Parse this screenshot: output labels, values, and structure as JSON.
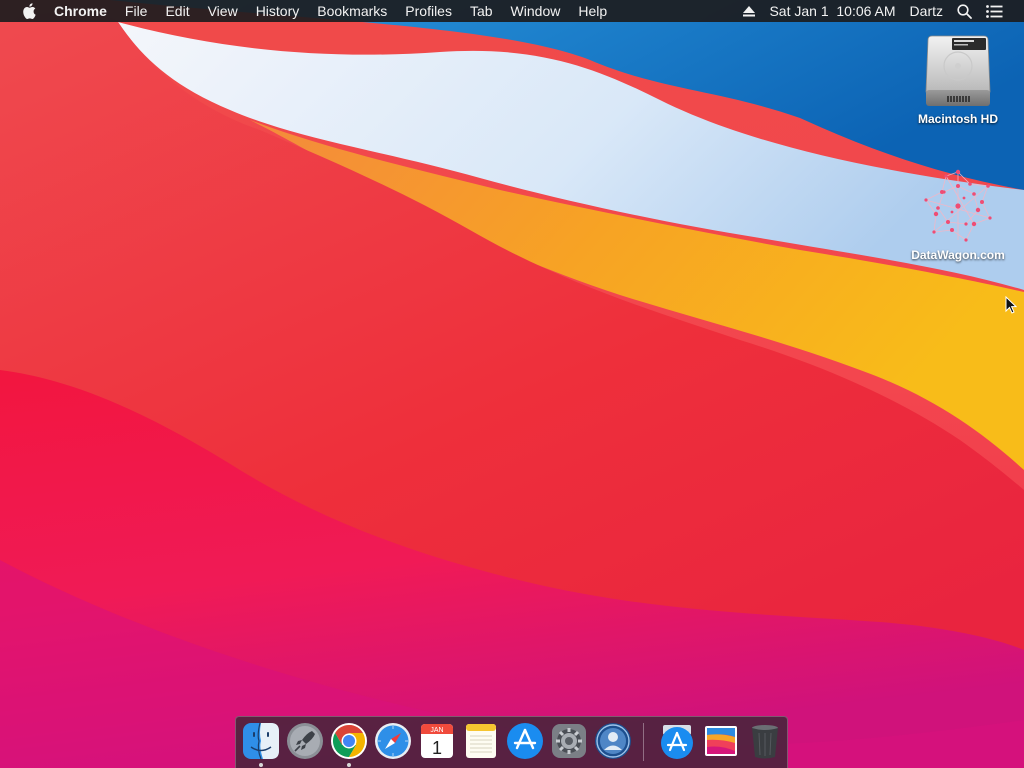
{
  "menubar": {
    "app_name": "Chrome",
    "menus": [
      "File",
      "Edit",
      "View",
      "History",
      "Bookmarks",
      "Profiles",
      "Tab",
      "Window",
      "Help"
    ],
    "clock": "Sat Jan 1  10:06 AM",
    "user": "Dartz"
  },
  "desktop": {
    "icons": [
      {
        "label": "Macintosh HD",
        "icon": "hard-drive-icon"
      },
      {
        "label": "DataWagon.com",
        "icon": "datawagon-icon"
      }
    ]
  },
  "dock": {
    "calendar_month": "JAN",
    "calendar_day": "1",
    "apps": [
      "finder-icon",
      "launchpad-icon",
      "chrome-icon",
      "safari-icon",
      "calendar-icon",
      "notes-icon",
      "app-store-icon",
      "system-preferences-icon",
      "directory-utility-icon",
      "app-store-downloads-icon",
      "big-sur-installer-icon",
      "trash-icon"
    ]
  },
  "colors": {
    "menubar": "#1c1c1e",
    "wallpaper_blue": "#1679c8",
    "wallpaper_light": "#e6f0fb",
    "wallpaper_orange": "#f6a324",
    "wallpaper_red": "#ee2b3d",
    "wallpaper_magenta": "#e9127a"
  }
}
